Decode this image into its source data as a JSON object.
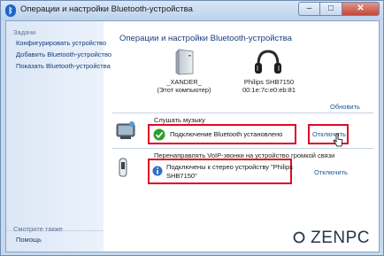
{
  "window": {
    "title": "Операции и настройки Bluetooth-устройства",
    "min_glyph": "–",
    "max_glyph": "□",
    "close_glyph": "✕"
  },
  "sidebar": {
    "tasks_heading": "Задачи",
    "items": [
      {
        "label": "Конфигурировать устройство"
      },
      {
        "label": "Добавить Bluetooth-устройство"
      },
      {
        "label": "Показать Bluetooth-устройства"
      }
    ],
    "see_also_heading": "Смотрите также",
    "help_link": "Помощь"
  },
  "main": {
    "title": "Операции и настройки Bluetooth-устройства",
    "computer_name": "_XANDER_",
    "computer_desc": "(Этот компьютер)",
    "device_name": "Philips SHB7150",
    "device_address": "00:1e:7c:e0:eb:81",
    "refresh_link": "Обновить"
  },
  "music": {
    "heading": "Слушать музыку",
    "status": "Подключение Bluetooth установлено",
    "action": "Отключить"
  },
  "voip": {
    "heading": "Перенаправлять VoIP-звонки на устройство громкой связи",
    "status_line1": "Подключены к стерео устройству \"Philips",
    "status_line2": "SHB7150\"",
    "action": "Отключить"
  },
  "watermark": {
    "text": "ZENPC"
  }
}
